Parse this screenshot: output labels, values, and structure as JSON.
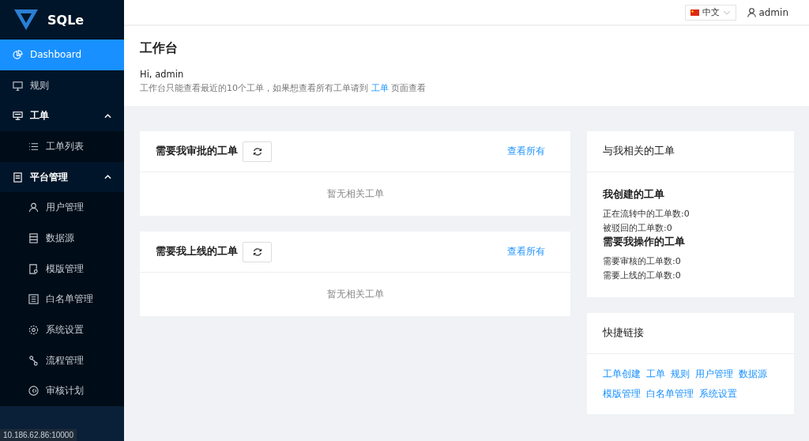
{
  "logo": {
    "text": "SQLe"
  },
  "menu": [
    {
      "label": "Dashboard",
      "selected": true
    },
    {
      "label": "规则",
      "selected": false
    },
    {
      "label": "工单",
      "selected": false,
      "expanded": true,
      "children": [
        {
          "label": "工单列表",
          "selected": false
        }
      ]
    },
    {
      "label": "平台管理",
      "selected": false,
      "expanded": true,
      "children": [
        {
          "label": "用户管理",
          "selected": false
        },
        {
          "label": "数据源",
          "selected": false
        },
        {
          "label": "模版管理",
          "selected": false
        },
        {
          "label": "白名单管理",
          "selected": false
        },
        {
          "label": "系统设置",
          "selected": false
        },
        {
          "label": "流程管理",
          "selected": false
        },
        {
          "label": "审核计划",
          "selected": false
        }
      ]
    }
  ],
  "status_url": "10.186.62.86:10000",
  "header": {
    "language": "中文",
    "user": "admin"
  },
  "page": {
    "title": "工作台",
    "greeting": "Hi, admin",
    "note_before": "工作台只能查看最近的10个工单，如果想查看所有工单请到",
    "note_link": "工单",
    "note_after": "页面查看"
  },
  "panels": [
    {
      "title": "需要我审批的工单",
      "link": "查看所有",
      "empty": "暂无相关工单"
    },
    {
      "title": "需要我上线的工单",
      "link": "查看所有",
      "empty": "暂无相关工单"
    }
  ],
  "related": {
    "title": "与我相关的工单",
    "sections": [
      {
        "heading": "我创建的工单",
        "lines": [
          "正在流转中的工单数:0",
          "被驳回的工单数:0"
        ]
      },
      {
        "heading": "需要我操作的工单",
        "lines": [
          "需要审核的工单数:0",
          "需要上线的工单数:0"
        ]
      }
    ]
  },
  "quick_links": {
    "title": "快捷链接",
    "links": [
      "工单创建",
      "工单",
      "规则",
      "用户管理",
      "数据源",
      "模版管理",
      "白名单管理",
      "系统设置"
    ]
  }
}
